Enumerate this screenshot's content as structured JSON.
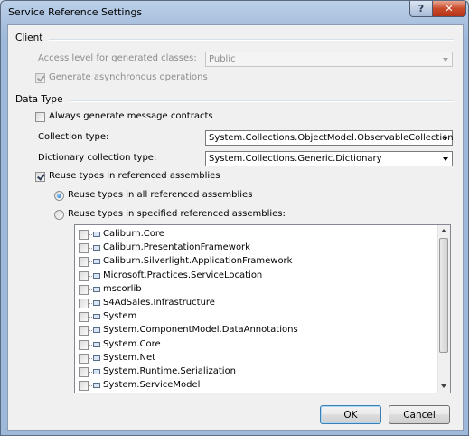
{
  "window": {
    "title": "Service Reference Settings"
  },
  "client_group": {
    "title": "Client",
    "access_level_label": "Access level for generated classes:",
    "access_level_value": "Public",
    "generate_async_label": "Generate asynchronous operations",
    "generate_async_checked": true
  },
  "data_type_group": {
    "title": "Data Type",
    "always_generate_label": "Always generate message contracts",
    "always_generate_checked": false,
    "collection_type_label": "Collection type:",
    "collection_type_value": "System.Collections.ObjectModel.ObservableCollection",
    "dictionary_type_label": "Dictionary collection type:",
    "dictionary_type_value": "System.Collections.Generic.Dictionary",
    "reuse_types_label": "Reuse types in referenced assemblies",
    "reuse_types_checked": true,
    "reuse_all_label": "Reuse types in all referenced assemblies",
    "reuse_all_selected": true,
    "reuse_specified_label": "Reuse types in specified referenced assemblies:",
    "reuse_specified_selected": false
  },
  "assemblies": [
    {
      "name": "Caliburn.Core",
      "checked": false
    },
    {
      "name": "Caliburn.PresentationFramework",
      "checked": false
    },
    {
      "name": "Caliburn.Silverlight.ApplicationFramework",
      "checked": false
    },
    {
      "name": "Microsoft.Practices.ServiceLocation",
      "checked": false
    },
    {
      "name": "mscorlib",
      "checked": false
    },
    {
      "name": "S4AdSales.Infrastructure",
      "checked": false
    },
    {
      "name": "System",
      "checked": false
    },
    {
      "name": "System.ComponentModel.DataAnnotations",
      "checked": false
    },
    {
      "name": "System.Core",
      "checked": false
    },
    {
      "name": "System.Net",
      "checked": false
    },
    {
      "name": "System.Runtime.Serialization",
      "checked": false
    },
    {
      "name": "System.ServiceModel",
      "checked": false
    }
  ],
  "buttons": {
    "ok_label": "OK",
    "cancel_label": "Cancel"
  },
  "icons": {
    "help": "?",
    "close": "✕"
  }
}
